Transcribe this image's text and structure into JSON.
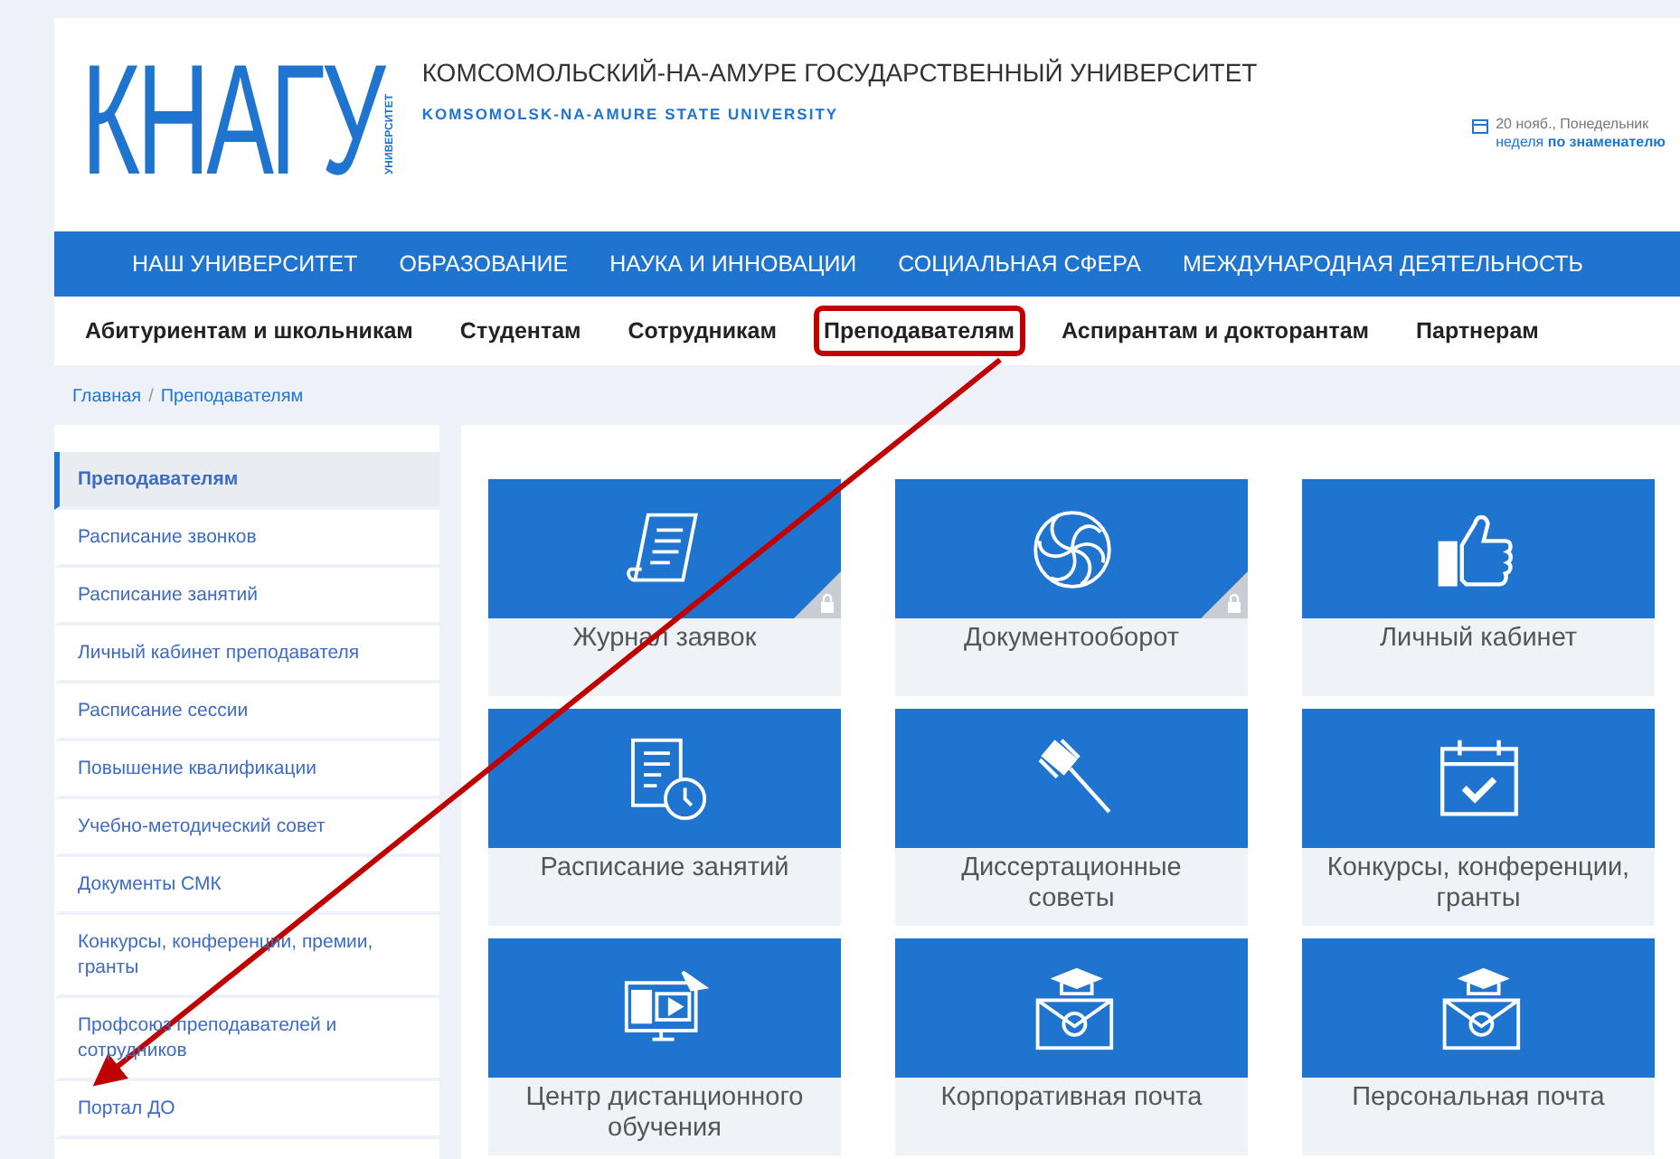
{
  "header": {
    "logo": "КНАГУ",
    "logo_caption": "УНИВЕРСИТЕТ",
    "title": "КОМСОМОЛЬСКИЙ-НА-АМУРЕ ГОСУДАРСТВЕННЫЙ УНИВЕРСИТЕТ",
    "subtitle": "KOMSOMOLSK-NA-AMURE STATE UNIVERSITY",
    "date": "20 нояб., Понедельник",
    "week": "неделя **по знаменателю**"
  },
  "main_nav": [
    "НАШ УНИВЕРСИТЕТ",
    "ОБРАЗОВАНИЕ",
    "НАУКА И ИННОВАЦИИ",
    "СОЦИАЛЬНАЯ СФЕРА",
    "МЕЖДУНАРОДНАЯ ДЕЯТЕЛЬНОСТЬ"
  ],
  "audience_nav": [
    {
      "label": "Абитуриентам и школьникам",
      "highlighted": false
    },
    {
      "label": "Студентам",
      "highlighted": false
    },
    {
      "label": "Сотрудникам",
      "highlighted": false
    },
    {
      "label": "Преподавателям",
      "highlighted": true
    },
    {
      "label": "Аспирантам и докторантам",
      "highlighted": false
    },
    {
      "label": "Партнерам",
      "highlighted": false
    }
  ],
  "breadcrumb": {
    "separator": "/",
    "items": [
      "Главная",
      "Преподавателям"
    ]
  },
  "sidebar": {
    "items": [
      {
        "label": "Преподавателям",
        "selected": true
      },
      {
        "label": "Расписание звонков",
        "selected": false
      },
      {
        "label": "Расписание занятий",
        "selected": false
      },
      {
        "label": "Личный кабинет преподавателя",
        "selected": false
      },
      {
        "label": "Расписание сессии",
        "selected": false
      },
      {
        "label": "Повышение квалификации",
        "selected": false
      },
      {
        "label": "Учебно-методический совет",
        "selected": false
      },
      {
        "label": "Документы СМК",
        "selected": false
      },
      {
        "label": "Конкурсы, конференции, премии, гранты",
        "selected": false
      },
      {
        "label": "Профсоюз преподавателей и сотрудников",
        "selected": false
      },
      {
        "label": "Портал ДО",
        "selected": false
      }
    ]
  },
  "tiles": [
    {
      "label": "Журнал заявок",
      "locked": true
    },
    {
      "label": "Документооборот",
      "locked": true
    },
    {
      "label": "Личный кабинет",
      "locked": false
    },
    {
      "label": "Расписание занятий",
      "locked": false
    },
    {
      "label": "Диссертационные советы",
      "locked": false
    },
    {
      "label": "Конкурсы, конференции, гранты",
      "locked": false
    },
    {
      "label": "Центр дистанционного обучения",
      "locked": false
    },
    {
      "label": "Корпоративная почта",
      "locked": false
    },
    {
      "label": "Персональная почта",
      "locked": false
    }
  ]
}
